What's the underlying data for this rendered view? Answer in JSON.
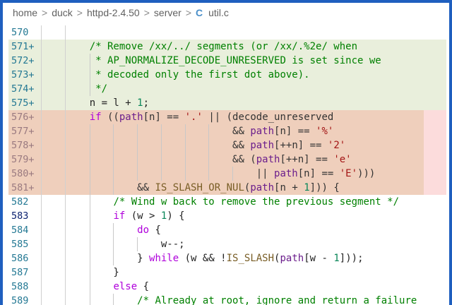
{
  "breadcrumb": [
    "home",
    "duck",
    "httpd-2.4.50",
    "server",
    "util.c"
  ],
  "file_icon": "c-file-icon",
  "current_line": 583,
  "lines": [
    {
      "n": "570",
      "kind": "ctx",
      "tokens": []
    },
    {
      "n": "571+",
      "kind": "add",
      "tokens": [
        [
          "    ",
          "pl"
        ],
        [
          "/* Remove /xx/../ segments (or /xx/.%2e/ when",
          "cm"
        ]
      ]
    },
    {
      "n": "572+",
      "kind": "add",
      "tokens": [
        [
          "     ",
          "pl"
        ],
        [
          "* AP_NORMALIZE_DECODE_UNRESERVED is set since we",
          "cm"
        ]
      ]
    },
    {
      "n": "573+",
      "kind": "add",
      "tokens": [
        [
          "     ",
          "pl"
        ],
        [
          "* decoded only the first dot above).",
          "cm"
        ]
      ]
    },
    {
      "n": "574+",
      "kind": "add",
      "tokens": [
        [
          "     ",
          "pl"
        ],
        [
          "*/",
          "cm"
        ]
      ]
    },
    {
      "n": "575+",
      "kind": "add",
      "tokens": [
        [
          "    ",
          "pl"
        ],
        [
          "n = l + ",
          "pl"
        ],
        [
          "1",
          "num"
        ],
        [
          ";",
          "pl"
        ]
      ]
    },
    {
      "n": "576+",
      "kind": "del",
      "tokens": [
        [
          "    ",
          "pl"
        ],
        [
          "if",
          "kw"
        ],
        [
          " ((",
          "op"
        ],
        [
          "path",
          "var"
        ],
        [
          "[n] == ",
          "op"
        ],
        [
          "'.'",
          "str"
        ],
        [
          " || (decode_unreserved",
          "op"
        ]
      ]
    },
    {
      "n": "577+",
      "kind": "del",
      "tokens": [
        [
          "                            ",
          "pl"
        ],
        [
          "&& ",
          "op"
        ],
        [
          "path",
          "var"
        ],
        [
          "[n] == ",
          "op"
        ],
        [
          "'%'",
          "str"
        ]
      ]
    },
    {
      "n": "578+",
      "kind": "del",
      "tokens": [
        [
          "                            ",
          "pl"
        ],
        [
          "&& ",
          "op"
        ],
        [
          "path",
          "var"
        ],
        [
          "[++n] == ",
          "op"
        ],
        [
          "'2'",
          "str"
        ]
      ]
    },
    {
      "n": "579+",
      "kind": "del",
      "tokens": [
        [
          "                            ",
          "pl"
        ],
        [
          "&& (",
          "op"
        ],
        [
          "path",
          "var"
        ],
        [
          "[++n] == ",
          "op"
        ],
        [
          "'e'",
          "str"
        ]
      ]
    },
    {
      "n": "580+",
      "kind": "del",
      "tokens": [
        [
          "                                ",
          "pl"
        ],
        [
          "|| ",
          "op"
        ],
        [
          "path",
          "var"
        ],
        [
          "[n] == ",
          "op"
        ],
        [
          "'E'",
          "str"
        ],
        [
          ")))",
          "op"
        ]
      ]
    },
    {
      "n": "581+",
      "kind": "del",
      "tokens": [
        [
          "            ",
          "pl"
        ],
        [
          "&& ",
          "op"
        ],
        [
          "IS_SLASH_OR_NUL",
          "fn"
        ],
        [
          "(",
          "op"
        ],
        [
          "path",
          "var"
        ],
        [
          "[n + ",
          "op"
        ],
        [
          "1",
          "num"
        ],
        [
          "])) {",
          "op"
        ]
      ]
    },
    {
      "n": "582",
      "kind": "ctx",
      "tokens": [
        [
          "        ",
          "pl"
        ],
        [
          "/* Wind w back to remove the previous segment */",
          "cm"
        ]
      ]
    },
    {
      "n": "583",
      "kind": "ctx",
      "tokens": [
        [
          "        ",
          "pl"
        ],
        [
          "if",
          "kw"
        ],
        [
          " (w > ",
          "pl"
        ],
        [
          "1",
          "num"
        ],
        [
          ") {",
          "pl"
        ]
      ]
    },
    {
      "n": "584",
      "kind": "ctx",
      "tokens": [
        [
          "            ",
          "pl"
        ],
        [
          "do",
          "kw"
        ],
        [
          " {",
          "pl"
        ]
      ]
    },
    {
      "n": "585",
      "kind": "ctx",
      "tokens": [
        [
          "                ",
          "pl"
        ],
        [
          "w--;",
          "pl"
        ]
      ]
    },
    {
      "n": "586",
      "kind": "ctx",
      "tokens": [
        [
          "            } ",
          "pl"
        ],
        [
          "while",
          "kw"
        ],
        [
          " (w && !",
          "pl"
        ],
        [
          "IS_SLASH",
          "fn"
        ],
        [
          "(",
          "pl"
        ],
        [
          "path",
          "var"
        ],
        [
          "[w - ",
          "pl"
        ],
        [
          "1",
          "num"
        ],
        [
          "]));",
          "pl"
        ]
      ]
    },
    {
      "n": "587",
      "kind": "ctx",
      "tokens": [
        [
          "        }",
          "pl"
        ]
      ]
    },
    {
      "n": "588",
      "kind": "ctx",
      "tokens": [
        [
          "        ",
          "pl"
        ],
        [
          "else",
          "kw"
        ],
        [
          " {",
          "pl"
        ]
      ]
    },
    {
      "n": "589",
      "kind": "ctx",
      "tokens": [
        [
          "            ",
          "pl"
        ],
        [
          "/* Already at root, ignore and return a failure",
          "cm"
        ]
      ]
    }
  ]
}
